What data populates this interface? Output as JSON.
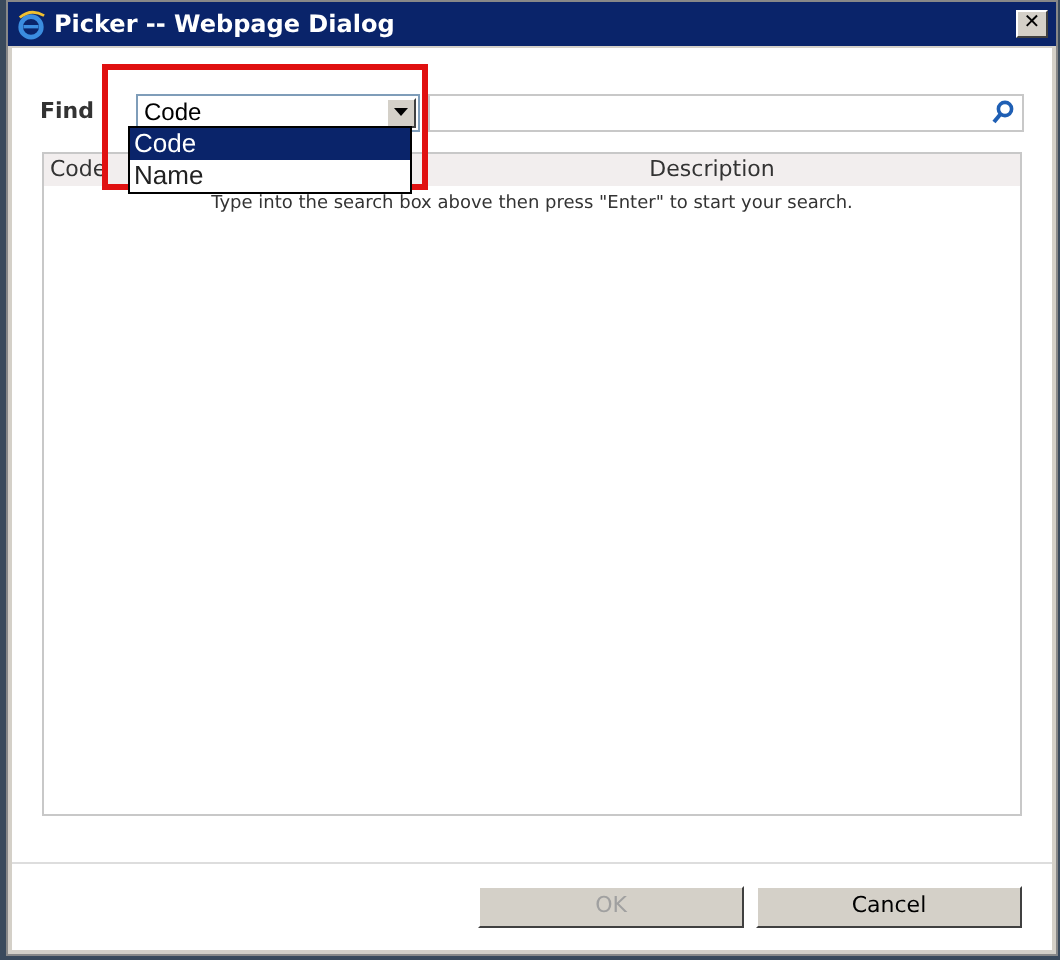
{
  "window": {
    "title": "Picker -- Webpage Dialog",
    "close": "✕"
  },
  "find": {
    "label": "Find",
    "select_value": "Code",
    "expanded": true,
    "options": [
      {
        "label": "Code",
        "selected": true
      },
      {
        "label": "Name",
        "selected": false
      }
    ]
  },
  "table": {
    "columns": [
      "Code",
      "Description"
    ],
    "message": "Type into the search box above then press \"Enter\" to start your search."
  },
  "buttons": [
    {
      "label": "OK",
      "disabled": true
    },
    {
      "label": "Cancel",
      "disabled": false
    }
  ]
}
